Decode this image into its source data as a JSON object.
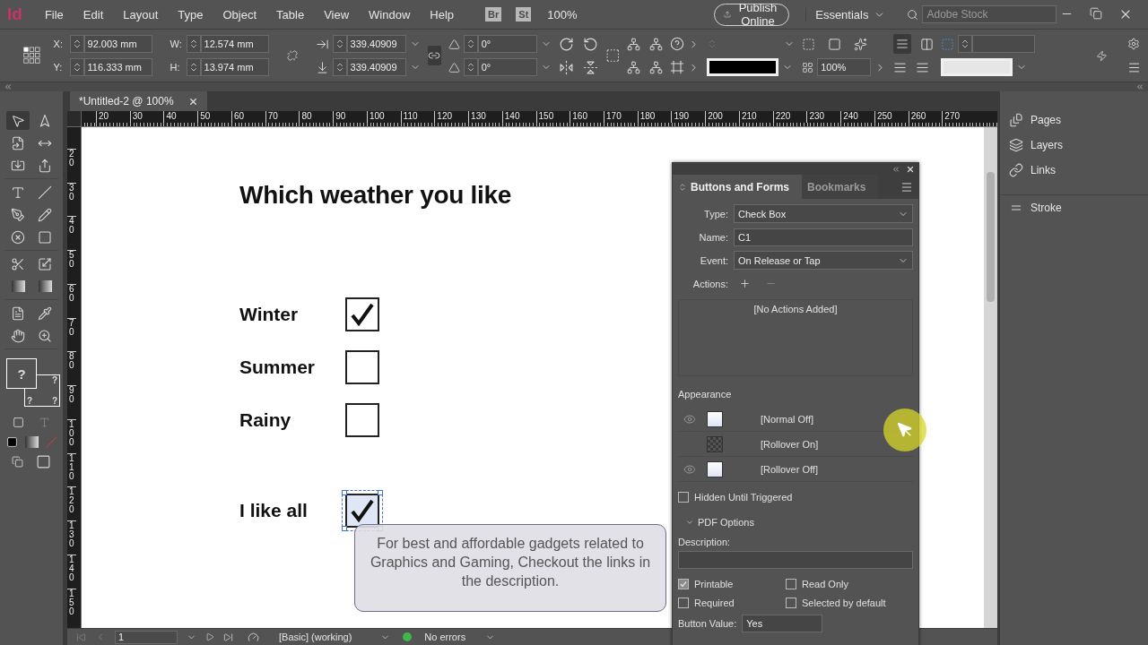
{
  "menu_bar": {
    "logo": "Id",
    "menus": [
      "File",
      "Edit",
      "Layout",
      "Type",
      "Object",
      "Table",
      "View",
      "Window",
      "Help"
    ],
    "bridge": "Br",
    "stock": "St",
    "zoom": "100%",
    "publish": "Publish Online",
    "workspace": "Essentials",
    "search_placeholder": "Adobe Stock"
  },
  "control_bar": {
    "position": [
      {
        "label": "X:",
        "value": "92.003 mm"
      },
      {
        "label": "Y:",
        "value": "116.333 mm"
      }
    ],
    "size": [
      {
        "label": "W:",
        "value": "12.574 mm"
      },
      {
        "label": "H:",
        "value": "13.974 mm"
      }
    ],
    "scale": [
      "339.40909",
      "339.40909"
    ],
    "angles": [
      "0°",
      "0°"
    ],
    "opacity": "100%"
  },
  "tools": {
    "fill": "?",
    "stroke": [
      "?",
      "?",
      "?"
    ]
  },
  "document_tab": {
    "title": "*Untitled-2 @ 100%"
  },
  "rulers": {
    "horizontal": [
      "20",
      "30",
      "40",
      "50",
      "60",
      "70",
      "80",
      "90",
      "100",
      "110",
      "120",
      "130",
      "140",
      "150",
      "160",
      "170",
      "180",
      "190",
      "200",
      "210",
      "220",
      "230",
      "240",
      "250",
      "260",
      "270"
    ],
    "vertical": [
      "20",
      "30",
      "40",
      "50",
      "60",
      "70",
      "80",
      "90",
      "100",
      "110",
      "120",
      "130",
      "140",
      "150"
    ]
  },
  "page": {
    "heading": "Which weather you like",
    "options": [
      {
        "label": "Winter",
        "checked": true,
        "selected": false
      },
      {
        "label": "Summer",
        "checked": false,
        "selected": false
      },
      {
        "label": "Rainy",
        "checked": false,
        "selected": false
      },
      {
        "label": "I like all",
        "checked": true,
        "selected": true
      }
    ]
  },
  "panel": {
    "tabs": [
      {
        "label": "Buttons and Forms",
        "selected": true
      },
      {
        "label": "Bookmarks",
        "selected": false
      }
    ],
    "fields": [
      {
        "label": "Type:",
        "value": "Check Box",
        "kind": "dropdown"
      },
      {
        "label": "Name:",
        "value": "C1",
        "kind": "text"
      },
      {
        "label": "Event:",
        "value": "On Release or Tap",
        "kind": "dropdown"
      }
    ],
    "actions_label": "Actions:",
    "actions_empty": "[No Actions Added]",
    "appearance_label": "Appearance",
    "states": [
      {
        "name": "[Normal Off]",
        "visible": true
      },
      {
        "name": "[Rollover On]",
        "visible": false
      },
      {
        "name": "[Rollover Off]",
        "visible": true
      }
    ],
    "hidden_until_triggered": {
      "label": "Hidden Until Triggered",
      "checked": false
    },
    "pdf_options": {
      "title": "PDF Options",
      "description_label": "Description:",
      "checkboxes": [
        {
          "label": "Printable",
          "checked": true
        },
        {
          "label": "Read Only",
          "checked": false
        },
        {
          "label": "Required",
          "checked": false
        },
        {
          "label": "Selected by default",
          "checked": false
        }
      ],
      "button_value_label": "Button Value:",
      "button_value": "Yes"
    }
  },
  "dock": {
    "items": [
      {
        "label": "Pages",
        "kind": "pages"
      },
      {
        "label": "Layers",
        "kind": "layers"
      },
      {
        "label": "Links",
        "kind": "links"
      },
      {
        "label": "Stroke",
        "kind": "stroke"
      }
    ]
  },
  "status_bar": {
    "page": "1",
    "style": "[Basic] (working)",
    "preflight": "No errors"
  },
  "overlay": {
    "text": "For best and affordable gadgets related to Graphics and Gaming, Checkout the links in the description."
  }
}
